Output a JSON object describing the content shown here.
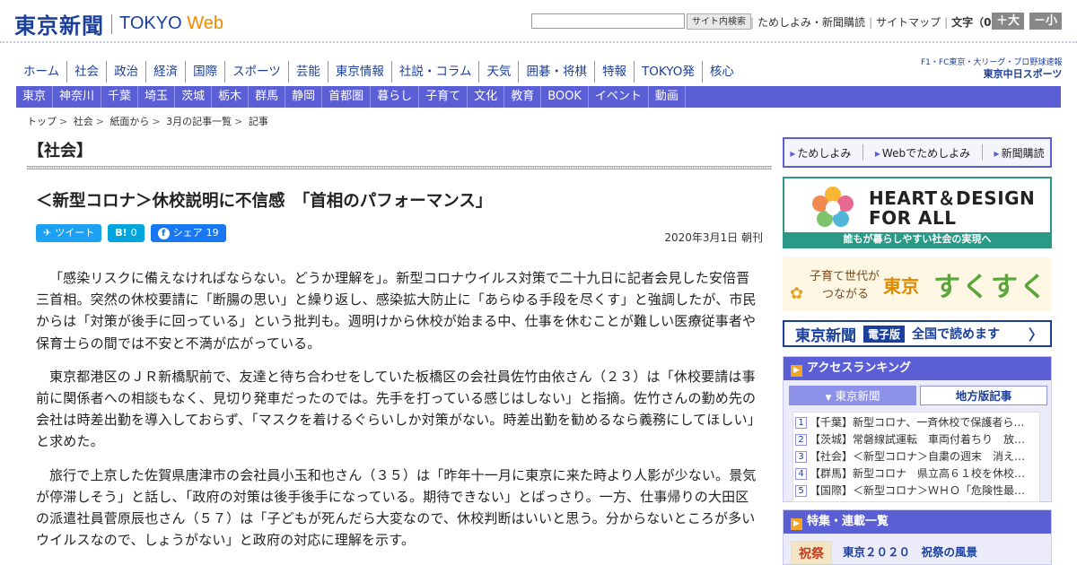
{
  "header": {
    "logo_jp": "東京新聞",
    "logo_en": "TOKYO",
    "logo_en_accent": "Web",
    "search_button": "サイト内検索",
    "top_links": [
      "ためしよみ・新聞購読",
      "サイトマップ"
    ],
    "font_size_label": "文字（0）",
    "font_bigger": "＋大",
    "font_smaller": "－小"
  },
  "main_nav": [
    "ホーム",
    "社会",
    "政治",
    "経済",
    "国際",
    "スポーツ",
    "芸能",
    "東京情報",
    "社説・コラム",
    "天気",
    "囲碁・将棋",
    "特報",
    "TOKYO発",
    "核心"
  ],
  "chunichi": {
    "line1": "F1・FC東京・大リーグ・プロ野球速報",
    "line2": "東京中日スポーツ"
  },
  "sub_nav": [
    "東京",
    "神奈川",
    "千葉",
    "埼玉",
    "茨城",
    "栃木",
    "群馬",
    "静岡",
    "首都圏",
    "暮らし",
    "子育て",
    "文化",
    "教育",
    "BOOK",
    "イベント",
    "動画"
  ],
  "breadcrumb": [
    "トップ",
    "社会",
    "紙面から",
    "3月の記事一覧",
    "記事"
  ],
  "article": {
    "category": "【社会】",
    "headline": "＜新型コロナ＞休校説明に不信感　「首相のパフォーマンス」",
    "social": {
      "tweet": "ツイート",
      "hatena_icon": "B!",
      "hatena_count": "0",
      "share": "シェア",
      "share_count": "19"
    },
    "date": "2020年3月1日 朝刊",
    "paragraphs": [
      "「感染リスクに備えなければならない。どうか理解を」。新型コロナウイルス対策で二十九日に記者会見した安倍晋三首相。突然の休校要請に「断腸の思い」と繰り返し、感染拡大防止に「あらゆる手段を尽くす」と強調したが、市民からは「対策が後手に回っている」という批判も。週明けから休校が始まる中、仕事を休むことが難しい医療従事者や保育士らの間では不安と不満が広がっている。",
      "東京都港区のＪＲ新橋駅前で、友達と待ち合わせをしていた板橋区の会社員佐竹由依さん（２３）は「休校要請は事前に関係者への相談もなく、見切り発車だったのでは。先手を打っている感じはしない」と指摘。佐竹さんの勤め先の会社は時差出勤を導入しておらず、「マスクを着けるぐらいしか対策がない。時差出勤を勧めるなら義務にしてほしい」と求めた。",
      "旅行で上京した佐賀県唐津市の会社員小玉和也さん（３５）は「昨年十一月に東京に来た時より人影が少ない。景気が停滞しそう」と話し、「政府の対策は後手後手になっている。期待できない」とばっさり。一方、仕事帰りの大田区の派遣社員菅原辰也さん（５７）は「子どもが死んだら大変なので、休校判断はいいと思う。分からないところが多いウイルスなので、しょうがない」と政府の対応に理解を示す。"
    ]
  },
  "sidebar": {
    "trial_links": [
      "ためしよみ",
      "Webでためしよみ",
      "新聞購読"
    ],
    "heart": {
      "line1": "HEART＆DESIGN",
      "line2": "FOR ALL",
      "caption": "誰もが暮らしやすい社会の実現へ"
    },
    "sukusuku": {
      "line1": "子育て世代が",
      "line2": "つながる",
      "big1": "東京",
      "big2": "すくすく"
    },
    "digital": {
      "logo": "東京新聞",
      "badge": "電子版",
      "text": "全国で読めます"
    },
    "ranking": {
      "title": "アクセスランキング",
      "tab_active": "東京新聞",
      "tab_inactive": "地方版記事",
      "items": [
        {
          "num": "1",
          "text": "【千葉】新型コロナ、一斉休校で保護者ら…"
        },
        {
          "num": "2",
          "text": "【茨城】常磐線試運転　車両付着ちり　放…"
        },
        {
          "num": "3",
          "text": "【社会】＜新型コロナ＞自粛の週末　消え…"
        },
        {
          "num": "4",
          "text": "【群馬】新型コロナ　県立高６１校を休校…"
        },
        {
          "num": "5",
          "text": "【国際】＜新型コロナ＞ＷＨＯ「危険性最…"
        }
      ]
    },
    "feature": {
      "title": "特集・連載一覧",
      "thumb": "祝祭",
      "item_title": "東京２０２０　祝祭の風景"
    }
  },
  "colors": {
    "brand": "#1a3f9c",
    "nav_bar": "#5b5fd6",
    "accent_orange": "#f08a00",
    "heart_green": "#2a9a87"
  }
}
